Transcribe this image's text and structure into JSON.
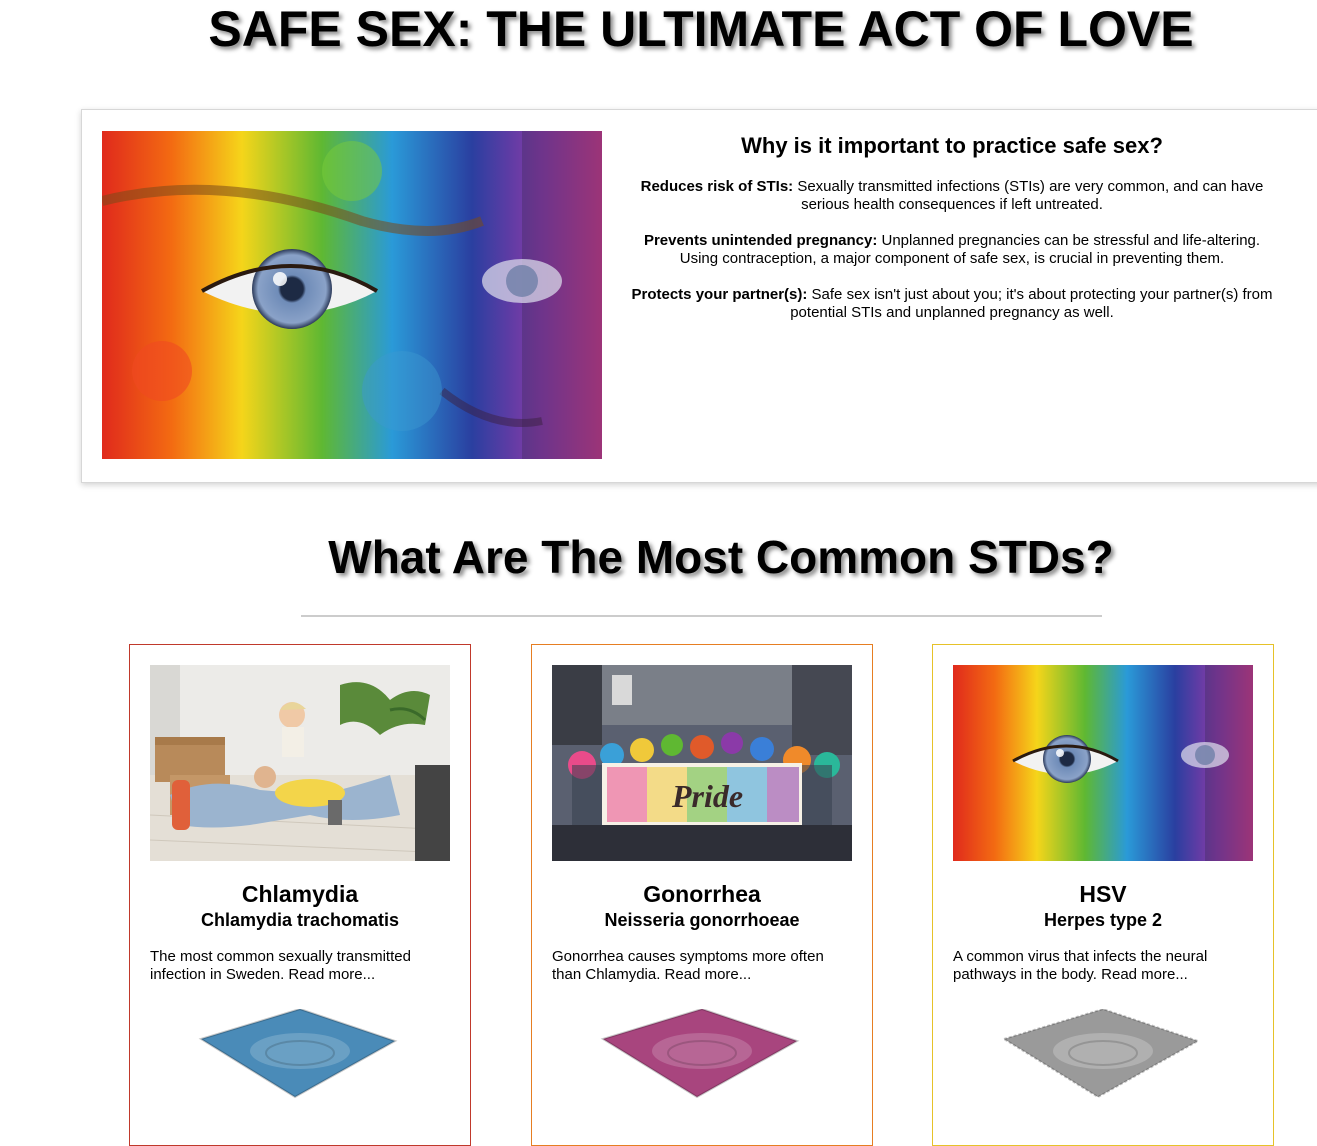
{
  "page": {
    "title": "SAFE SEX: THE ULTIMATE ACT OF LOVE"
  },
  "why": {
    "heading": "Why is it important to practice safe sex?",
    "points": [
      {
        "label": "Reduces risk of STIs:",
        "text": " Sexually transmitted infections (STIs) are very common, and can have serious health consequences if left untreated."
      },
      {
        "label": "Prevents unintended pregnancy:",
        "text": " Unplanned pregnancies can be stressful and life-altering. Using contraception, a major component of safe sex, is crucial in preventing them."
      },
      {
        "label": "Protects your partner(s):",
        "text": " Safe sex isn't just about you; it's about protecting your partner(s) from potential STIs and unplanned pregnancy as well."
      }
    ]
  },
  "stds": {
    "heading": "What Are The Most Common STDs?",
    "cards": [
      {
        "title": "Chlamydia",
        "subtitle": "Chlamydia trachomatis",
        "description": "The most common sexually transmitted infection in Sweden. Read more...",
        "border_color": "#c0392b",
        "condom_color": "#4a8bb8"
      },
      {
        "title": "Gonorrhea",
        "subtitle": "Neisseria gonorrhoeae",
        "description": "Gonorrhea causes symptoms more often than Chlamydia. Read more...",
        "border_color": "#e67e22",
        "condom_color": "#a8457e"
      },
      {
        "title": "HSV",
        "subtitle": "Herpes type 2",
        "description": "A common virus that infects the neural pathways in the body. Read more...",
        "border_color": "#e6c229",
        "condom_color": "#9a9a9a"
      }
    ],
    "banner_text": "Pride"
  }
}
